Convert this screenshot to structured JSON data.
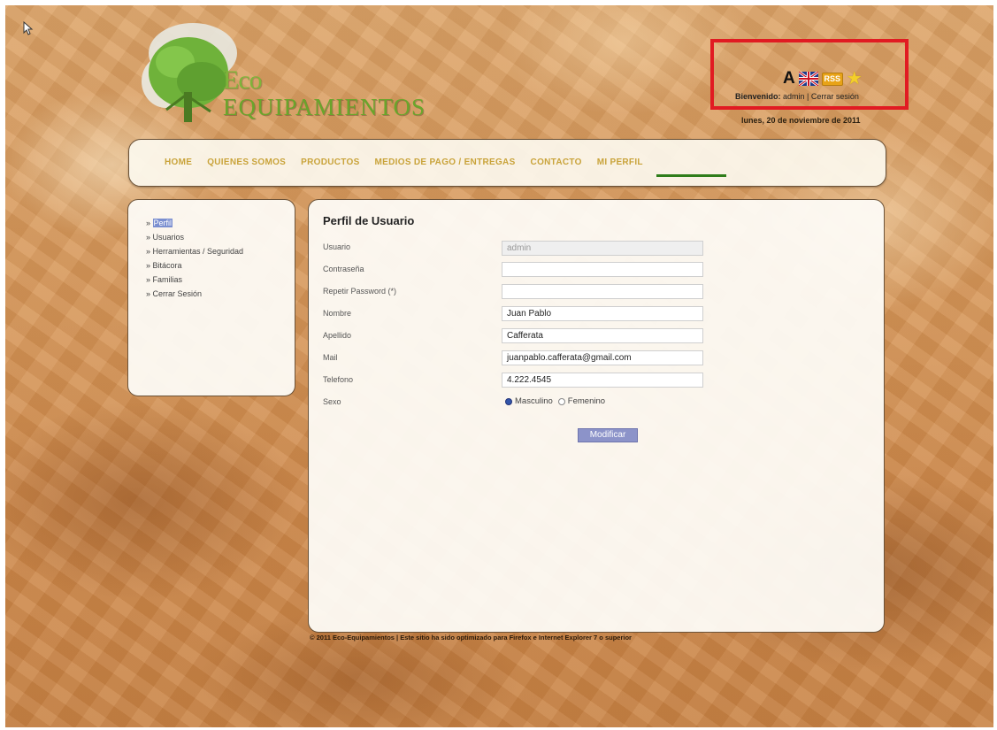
{
  "logo": {
    "line1": "Eco",
    "line2": "Equipamientos"
  },
  "header": {
    "font_size_letter": "A",
    "rss_label": "RSS",
    "welcome_prefix": "Bienvenido:",
    "user": "admin",
    "separator": " | ",
    "logout_link": "Cerrar sesión",
    "date": "lunes, 20 de noviembre de 2011"
  },
  "nav": {
    "items": [
      {
        "label": "HOME"
      },
      {
        "label": "QUIENES SOMOS"
      },
      {
        "label": "PRODUCTOS"
      },
      {
        "label": "MEDIOS DE PAGO / ENTREGAS"
      },
      {
        "label": "CONTACTO"
      },
      {
        "label": "MI PERFIL"
      }
    ],
    "active": "MI PERFIL"
  },
  "sidebar": {
    "items": [
      {
        "label": "Perfil"
      },
      {
        "label": "Usuarios"
      },
      {
        "label": "Herramientas / Seguridad"
      },
      {
        "label": "Bitácora"
      },
      {
        "label": "Familias"
      },
      {
        "label": "Cerrar Sesión"
      }
    ]
  },
  "form": {
    "title": "Perfil de Usuario",
    "usuario": {
      "label": "Usuario",
      "value": "admin"
    },
    "contrasena": {
      "label": "Contraseña",
      "value": ""
    },
    "repetir": {
      "label": "Repetir Password (*)",
      "value": ""
    },
    "nombre": {
      "label": "Nombre",
      "value": "Juan Pablo"
    },
    "apellido": {
      "label": "Apellido",
      "value": "Cafferata"
    },
    "mail": {
      "label": "Mail",
      "value": "juanpablo.cafferata@gmail.com"
    },
    "telefono": {
      "label": "Telefono",
      "value": "4.222.4545"
    },
    "sexo": {
      "label": "Sexo",
      "option1": "Masculino",
      "option2": "Femenino",
      "selected": "Masculino"
    },
    "submit_label": "Modificar"
  },
  "footer": {
    "text": "© 2011 Eco-Equipamientos | Este sitio ha sido optimizado para Firefox e Internet Explorer 7 o superior"
  },
  "colors": {
    "nav_text": "#c9a33a",
    "nav_active_underline": "#2f7d1a",
    "highlight_box": "#e11b22",
    "button_bg": "#8c93c9"
  }
}
